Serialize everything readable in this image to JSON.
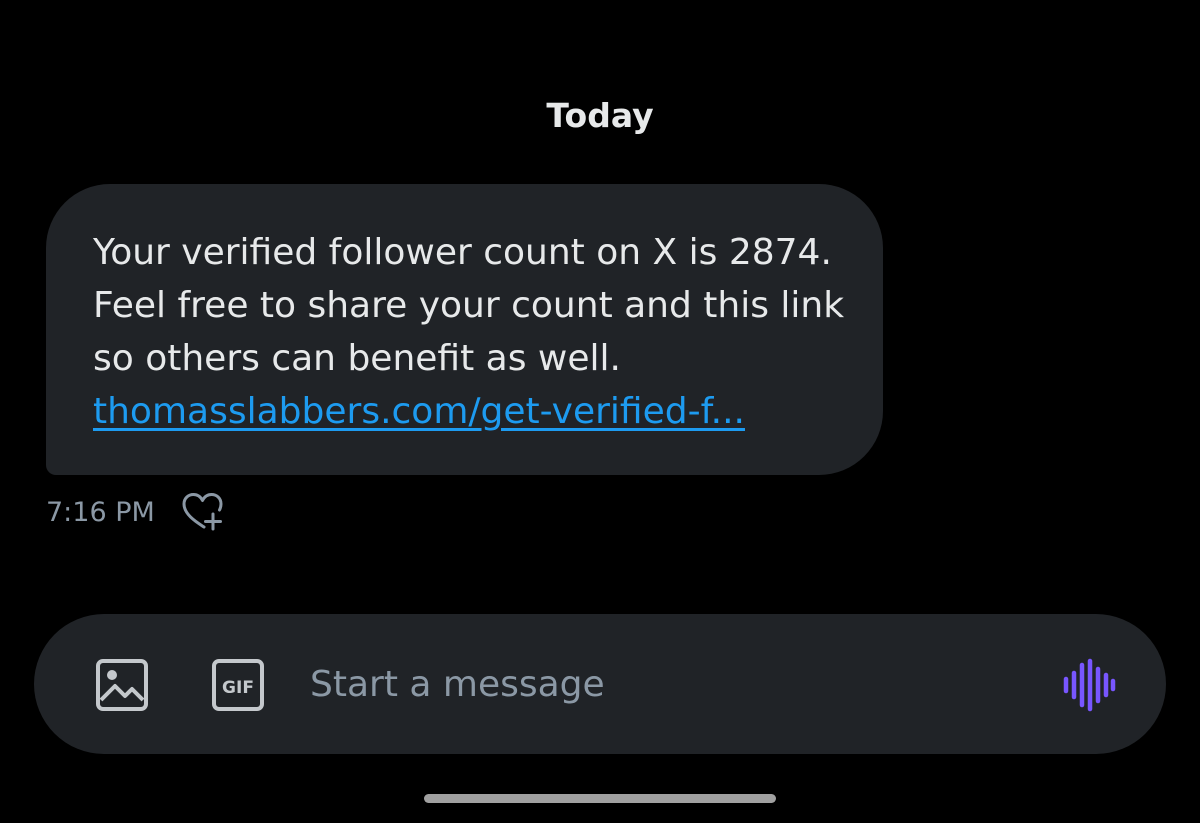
{
  "conversation": {
    "date_divider": "Today",
    "message": {
      "text": "Your verified follower count on X is 2874. Feel free to share your count and this link so others can benefit as well.",
      "link": "thomasslabbers.com/get-verified-f...",
      "timestamp": "7:16 PM",
      "react_icon": "heart-plus-icon"
    }
  },
  "composer": {
    "placeholder": "Start a message",
    "media_icon": "image-icon",
    "gif_label": "GIF",
    "voice_icon": "voice-waveform-icon"
  },
  "colors": {
    "background": "#000000",
    "bubble": "#202327",
    "text": "#e7e9ea",
    "link": "#1d9bf0",
    "muted": "#8b98a5",
    "voice_accent": "#7856ff"
  }
}
